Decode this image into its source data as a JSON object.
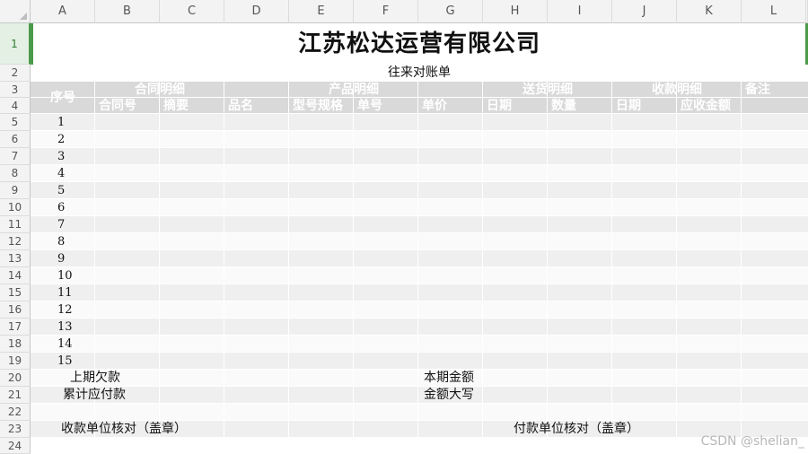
{
  "columns": [
    "A",
    "B",
    "C",
    "D",
    "E",
    "F",
    "G",
    "H",
    "I",
    "J",
    "K",
    "L"
  ],
  "rows": [
    "1",
    "2",
    "3",
    "4",
    "5",
    "6",
    "7",
    "8",
    "9",
    "10",
    "11",
    "12",
    "13",
    "14",
    "15",
    "16",
    "17",
    "18",
    "19",
    "20",
    "21",
    "22",
    "23",
    "24"
  ],
  "sheet": {
    "title": "江苏松达运营有限公司",
    "subtitle": "往来对账单",
    "header": {
      "seq": "序号",
      "contract_group": "合同明细",
      "contract_no": "合同号",
      "summary": "摘要",
      "product_group": "产品明细",
      "product_name": "品名",
      "model": "型号规格",
      "order_no": "单号",
      "unit_price": "单价",
      "delivery_group": "送货明细",
      "delivery_date": "日期",
      "quantity": "数量",
      "receipt_group": "收款明细",
      "receipt_date": "日期",
      "receivable": "应收金额",
      "remark": "备注"
    },
    "seq_numbers": [
      "1",
      "2",
      "3",
      "4",
      "5",
      "6",
      "7",
      "8",
      "9",
      "10",
      "11",
      "12",
      "13",
      "14",
      "15"
    ],
    "footer": {
      "prev_arrears": "上期欠款",
      "current_amount": "本期金额",
      "cumulative_payable": "累计应付款",
      "amount_in_words": "金额大写",
      "payee_verify": "收款单位核对（盖章）",
      "payer_verify": "付款单位核对（盖章）"
    }
  },
  "watermark": "CSDN @shelian_",
  "colors": {
    "header_band": "#d9d9d9",
    "row_gray": "#efefef",
    "row_white": "#fafafa",
    "selection_green": "#4a9a4a"
  }
}
